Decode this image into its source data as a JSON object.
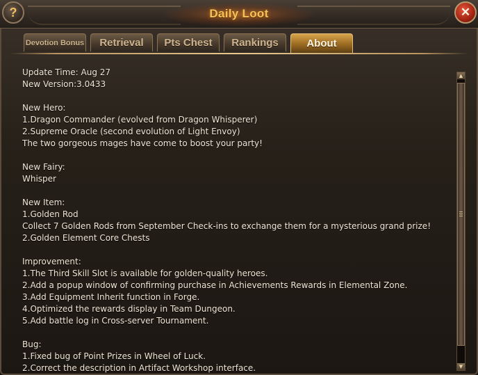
{
  "window": {
    "title": "Daily Loot",
    "help_glyph": "?",
    "close_glyph": "✕"
  },
  "tabs": [
    {
      "label": "Devotion Bonus",
      "active": false
    },
    {
      "label": "Retrieval",
      "active": false
    },
    {
      "label": "Pts Chest",
      "active": false
    },
    {
      "label": "Rankings",
      "active": false
    },
    {
      "label": "About",
      "active": true
    }
  ],
  "about": {
    "lines": [
      "Update Time: Aug 27",
      "New Version:3.0433",
      "",
      "New Hero:",
      "1.Dragon Commander (evolved from Dragon Whisperer)",
      "2.Supreme Oracle (second evolution of Light Envoy)",
      "The two gorgeous mages have come to boost your party!",
      "",
      "New Fairy:",
      "Whisper",
      "",
      "New Item:",
      "1.Golden Rod",
      "Collect 7 Golden Rods from September Check-ins to exchange them for a mysterious grand prize!",
      "2.Golden Element Core Chests",
      "",
      "Improvement:",
      "1.The Third Skill Slot is available for golden-quality heroes.",
      "2.Add a popup window of confirming purchase in Achievements Rewards in Elemental Zone.",
      "3.Add Equipment Inherit function in Forge.",
      "4.Optimized the rewards display in Team Dungeon.",
      "5.Add battle log in Cross-server Tournament.",
      "",
      "Bug:",
      "1.Fixed bug of Point Prizes in Wheel of Luck.",
      "2.Correct the description in Artifact Workshop interface."
    ]
  },
  "scrollbar": {
    "up_glyph": "▲",
    "down_glyph": "▼"
  },
  "colors": {
    "title": "#f3c35a",
    "text": "#efe6d6",
    "active_tab": "#d7a34a",
    "close_button": "#a22412"
  }
}
